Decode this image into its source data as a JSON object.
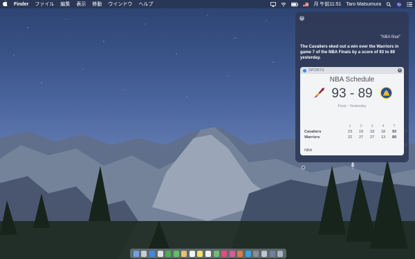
{
  "menubar": {
    "apple_icon": "apple-icon",
    "app_name": "Finder",
    "menus": [
      "ファイル",
      "編集",
      "表示",
      "移動",
      "ウインドウ",
      "ヘルプ"
    ],
    "clock": "月 午前11:51",
    "user_name": "Taro Matsumura"
  },
  "siri": {
    "query": "\"NBA final\"",
    "answer": "The Cavaliers eked out a win over the Warriors in game 7 of the NBA Finals by a score of 93 to 89 yesterday.",
    "card": {
      "category": "SPORTS",
      "title": "NBA Schedule",
      "score": "93 - 89",
      "status": "Final - Yesterday",
      "periods": [
        "1",
        "2",
        "3",
        "4",
        "T"
      ],
      "teams": [
        {
          "name": "Cavaliers",
          "scores": [
            "23",
            "19",
            "33",
            "18",
            "93"
          ]
        },
        {
          "name": "Warriors",
          "scores": [
            "22",
            "27",
            "27",
            "13",
            "89"
          ]
        }
      ],
      "footer": "NBA"
    }
  },
  "colors": {
    "menubar_bg": "#28324b",
    "siri_bg": "#303a56",
    "card_bg": "#f3f4f6",
    "cavaliers": "#8e1c2e",
    "warriors": "#1d4e9e"
  }
}
